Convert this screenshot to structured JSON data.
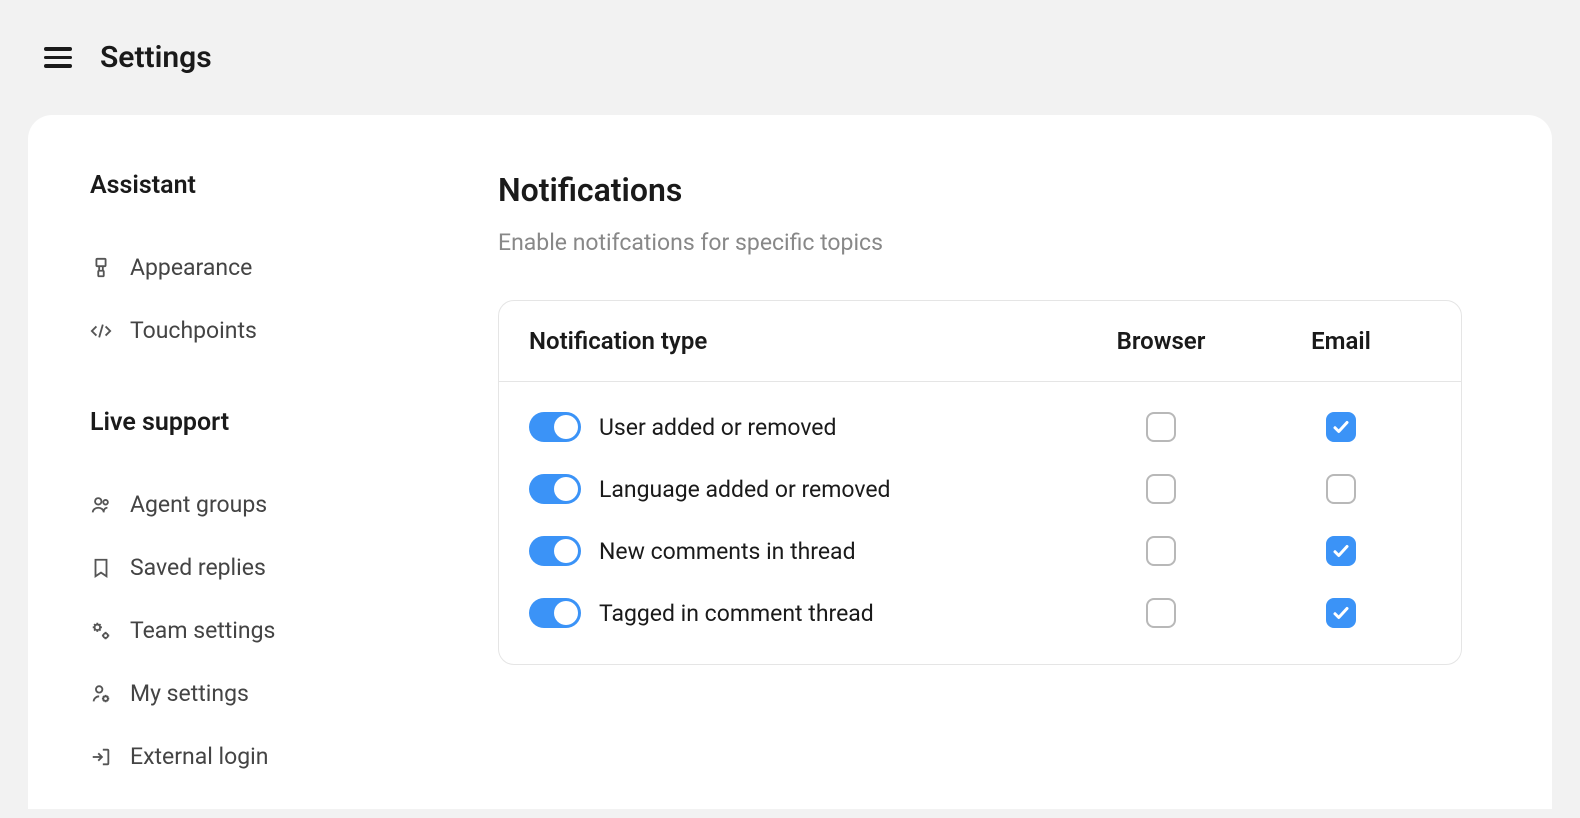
{
  "topbar": {
    "title": "Settings"
  },
  "sidebar": {
    "sections": [
      {
        "title": "Assistant",
        "items": [
          {
            "icon": "paintbrush",
            "label": "Appearance"
          },
          {
            "icon": "code",
            "label": "Touchpoints"
          }
        ]
      },
      {
        "title": "Live support",
        "items": [
          {
            "icon": "people",
            "label": "Agent groups"
          },
          {
            "icon": "bookmark",
            "label": "Saved replies"
          },
          {
            "icon": "gears",
            "label": "Team settings"
          },
          {
            "icon": "person-gear",
            "label": "My settings"
          },
          {
            "icon": "login",
            "label": "External login"
          }
        ]
      }
    ]
  },
  "content": {
    "title": "Notifications",
    "subtitle": "Enable notifcations for specific topics",
    "table": {
      "headers": {
        "type": "Notification type",
        "browser": "Browser",
        "email": "Email"
      },
      "rows": [
        {
          "enabled": true,
          "label": "User added or removed",
          "browser": false,
          "email": true
        },
        {
          "enabled": true,
          "label": "Language added or removed",
          "browser": false,
          "email": false
        },
        {
          "enabled": true,
          "label": "New comments in thread",
          "browser": false,
          "email": true
        },
        {
          "enabled": true,
          "label": "Tagged in comment thread",
          "browser": false,
          "email": true
        }
      ]
    }
  },
  "colors": {
    "accent": "#3b93f7"
  }
}
